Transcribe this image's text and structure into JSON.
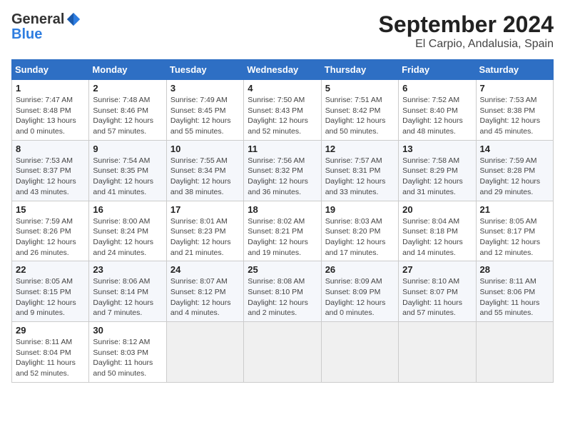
{
  "logo": {
    "general": "General",
    "blue": "Blue"
  },
  "title": "September 2024",
  "location": "El Carpio, Andalusia, Spain",
  "weekdays": [
    "Sunday",
    "Monday",
    "Tuesday",
    "Wednesday",
    "Thursday",
    "Friday",
    "Saturday"
  ],
  "weeks": [
    [
      {
        "day": "1",
        "sunrise": "7:47 AM",
        "sunset": "8:48 PM",
        "daylight": "13 hours and 0 minutes."
      },
      {
        "day": "2",
        "sunrise": "7:48 AM",
        "sunset": "8:46 PM",
        "daylight": "12 hours and 57 minutes."
      },
      {
        "day": "3",
        "sunrise": "7:49 AM",
        "sunset": "8:45 PM",
        "daylight": "12 hours and 55 minutes."
      },
      {
        "day": "4",
        "sunrise": "7:50 AM",
        "sunset": "8:43 PM",
        "daylight": "12 hours and 52 minutes."
      },
      {
        "day": "5",
        "sunrise": "7:51 AM",
        "sunset": "8:42 PM",
        "daylight": "12 hours and 50 minutes."
      },
      {
        "day": "6",
        "sunrise": "7:52 AM",
        "sunset": "8:40 PM",
        "daylight": "12 hours and 48 minutes."
      },
      {
        "day": "7",
        "sunrise": "7:53 AM",
        "sunset": "8:38 PM",
        "daylight": "12 hours and 45 minutes."
      }
    ],
    [
      {
        "day": "8",
        "sunrise": "7:53 AM",
        "sunset": "8:37 PM",
        "daylight": "12 hours and 43 minutes."
      },
      {
        "day": "9",
        "sunrise": "7:54 AM",
        "sunset": "8:35 PM",
        "daylight": "12 hours and 41 minutes."
      },
      {
        "day": "10",
        "sunrise": "7:55 AM",
        "sunset": "8:34 PM",
        "daylight": "12 hours and 38 minutes."
      },
      {
        "day": "11",
        "sunrise": "7:56 AM",
        "sunset": "8:32 PM",
        "daylight": "12 hours and 36 minutes."
      },
      {
        "day": "12",
        "sunrise": "7:57 AM",
        "sunset": "8:31 PM",
        "daylight": "12 hours and 33 minutes."
      },
      {
        "day": "13",
        "sunrise": "7:58 AM",
        "sunset": "8:29 PM",
        "daylight": "12 hours and 31 minutes."
      },
      {
        "day": "14",
        "sunrise": "7:59 AM",
        "sunset": "8:28 PM",
        "daylight": "12 hours and 29 minutes."
      }
    ],
    [
      {
        "day": "15",
        "sunrise": "7:59 AM",
        "sunset": "8:26 PM",
        "daylight": "12 hours and 26 minutes."
      },
      {
        "day": "16",
        "sunrise": "8:00 AM",
        "sunset": "8:24 PM",
        "daylight": "12 hours and 24 minutes."
      },
      {
        "day": "17",
        "sunrise": "8:01 AM",
        "sunset": "8:23 PM",
        "daylight": "12 hours and 21 minutes."
      },
      {
        "day": "18",
        "sunrise": "8:02 AM",
        "sunset": "8:21 PM",
        "daylight": "12 hours and 19 minutes."
      },
      {
        "day": "19",
        "sunrise": "8:03 AM",
        "sunset": "8:20 PM",
        "daylight": "12 hours and 17 minutes."
      },
      {
        "day": "20",
        "sunrise": "8:04 AM",
        "sunset": "8:18 PM",
        "daylight": "12 hours and 14 minutes."
      },
      {
        "day": "21",
        "sunrise": "8:05 AM",
        "sunset": "8:17 PM",
        "daylight": "12 hours and 12 minutes."
      }
    ],
    [
      {
        "day": "22",
        "sunrise": "8:05 AM",
        "sunset": "8:15 PM",
        "daylight": "12 hours and 9 minutes."
      },
      {
        "day": "23",
        "sunrise": "8:06 AM",
        "sunset": "8:14 PM",
        "daylight": "12 hours and 7 minutes."
      },
      {
        "day": "24",
        "sunrise": "8:07 AM",
        "sunset": "8:12 PM",
        "daylight": "12 hours and 4 minutes."
      },
      {
        "day": "25",
        "sunrise": "8:08 AM",
        "sunset": "8:10 PM",
        "daylight": "12 hours and 2 minutes."
      },
      {
        "day": "26",
        "sunrise": "8:09 AM",
        "sunset": "8:09 PM",
        "daylight": "12 hours and 0 minutes."
      },
      {
        "day": "27",
        "sunrise": "8:10 AM",
        "sunset": "8:07 PM",
        "daylight": "11 hours and 57 minutes."
      },
      {
        "day": "28",
        "sunrise": "8:11 AM",
        "sunset": "8:06 PM",
        "daylight": "11 hours and 55 minutes."
      }
    ],
    [
      {
        "day": "29",
        "sunrise": "8:11 AM",
        "sunset": "8:04 PM",
        "daylight": "11 hours and 52 minutes."
      },
      {
        "day": "30",
        "sunrise": "8:12 AM",
        "sunset": "8:03 PM",
        "daylight": "11 hours and 50 minutes."
      },
      null,
      null,
      null,
      null,
      null
    ]
  ]
}
